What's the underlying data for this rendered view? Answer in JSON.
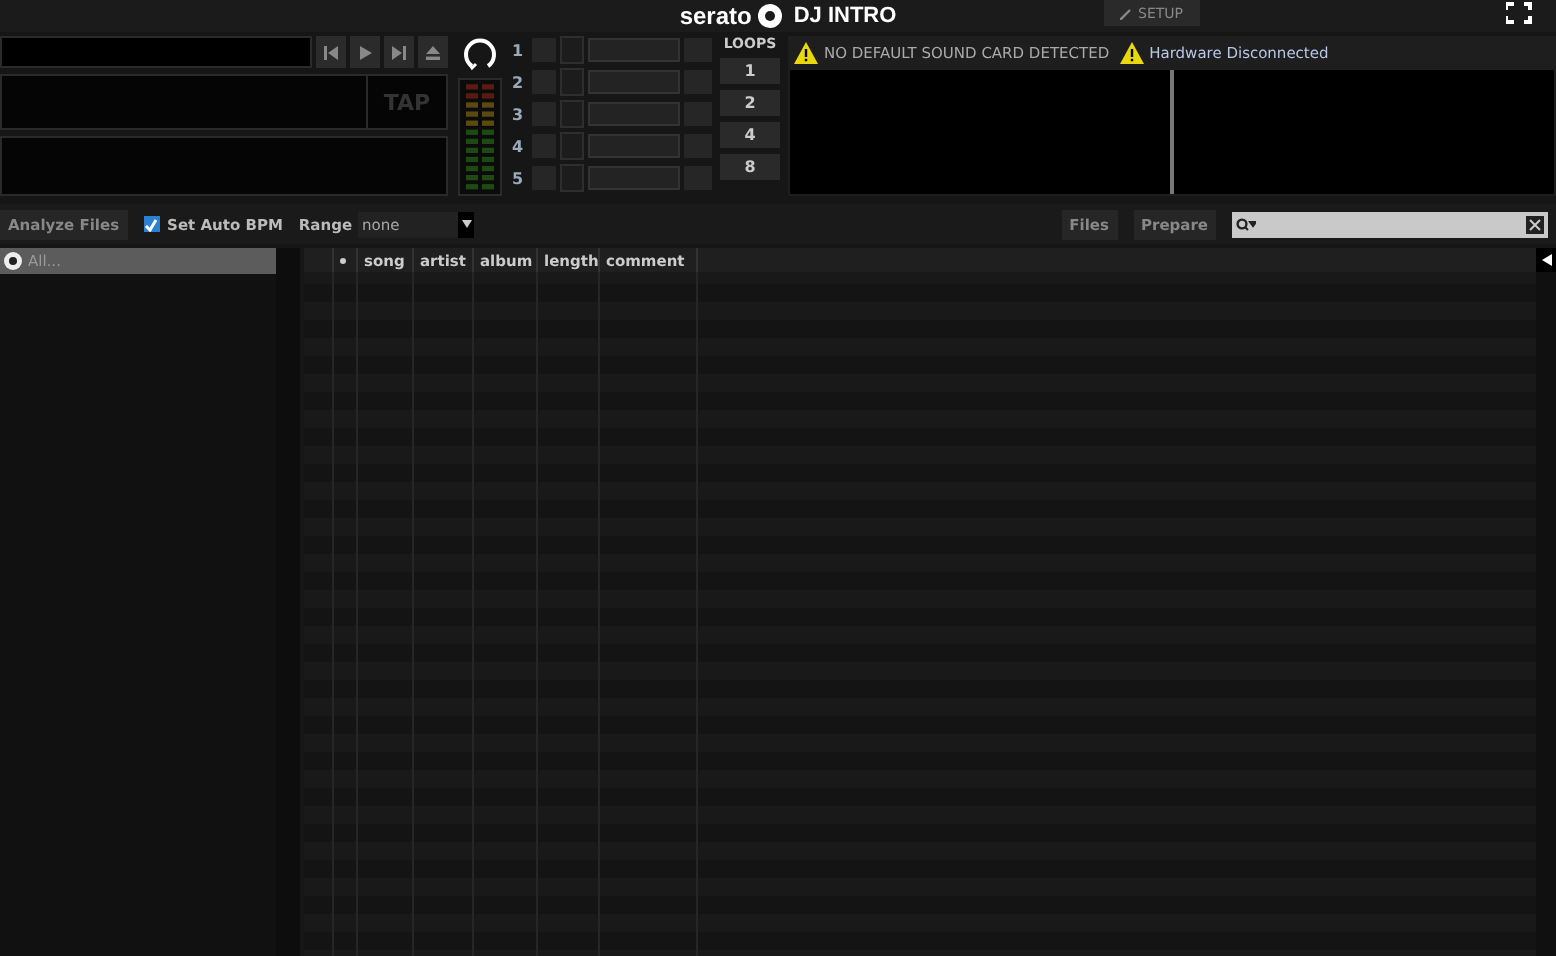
{
  "header": {
    "logo": "serato",
    "product": "DJ INTRO",
    "setup_button": "SETUP"
  },
  "deck": {
    "tap_button": "TAP",
    "cues": [
      {
        "number": "1"
      },
      {
        "number": "2"
      },
      {
        "number": "3"
      },
      {
        "number": "4"
      },
      {
        "number": "5"
      }
    ],
    "loops": {
      "title": "LOOPS",
      "buttons": [
        "1",
        "2",
        "4",
        "8"
      ]
    }
  },
  "alerts": [
    {
      "text": "NO DEFAULT SOUND CARD DETECTED"
    },
    {
      "text": "Hardware Disconnected"
    }
  ],
  "toolbar": {
    "analyze_button": "Analyze Files",
    "auto_bpm": {
      "label": "Set Auto BPM",
      "checked": true
    },
    "range": {
      "label": "Range",
      "value": "none"
    },
    "files_button": "Files",
    "prepare_button": "Prepare"
  },
  "sidebar": {
    "items": [
      {
        "label": "All...",
        "selected": true
      }
    ]
  },
  "table": {
    "columns": [
      "song",
      "artist",
      "album",
      "length",
      "comment"
    ]
  }
}
